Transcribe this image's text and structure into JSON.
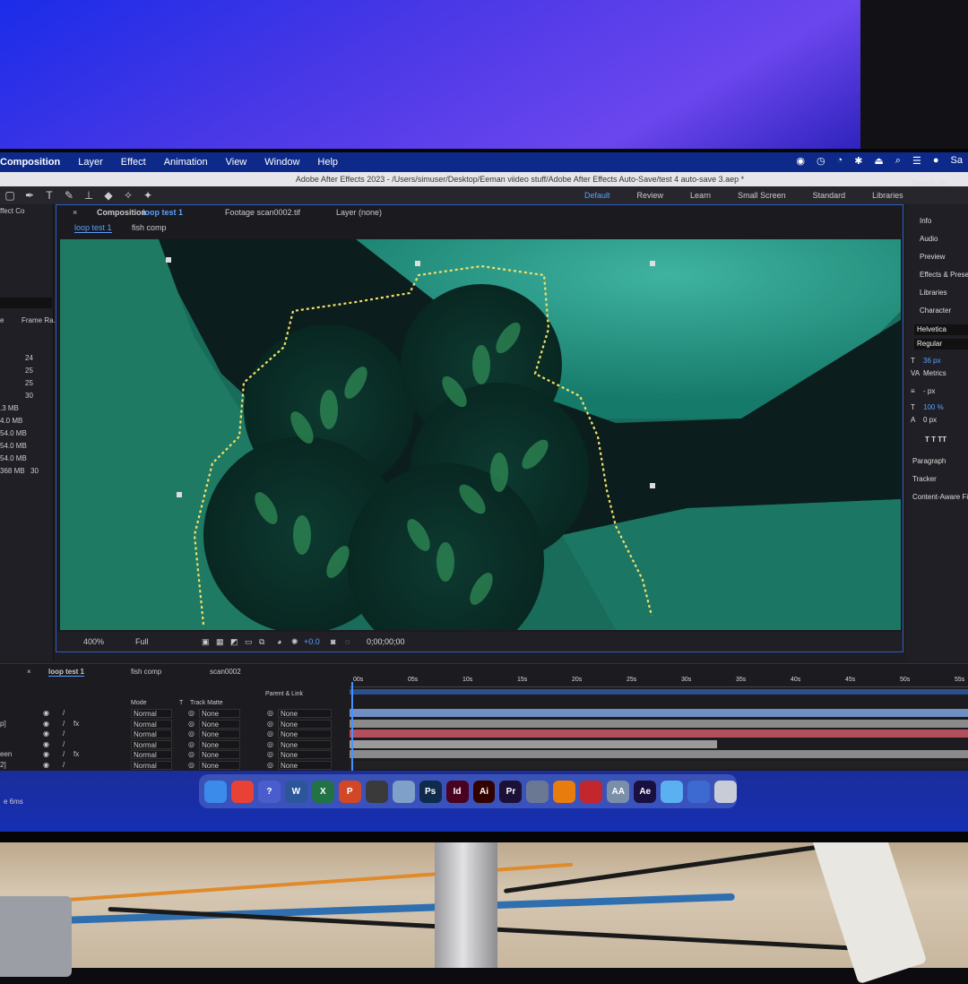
{
  "menubar": {
    "items": [
      "Composition",
      "Layer",
      "Effect",
      "Animation",
      "View",
      "Window",
      "Help"
    ],
    "right_label": "Sa"
  },
  "window_title": "Adobe After Effects 2023 - /Users/simuser/Desktop/Eeman viideo stuff/Adobe After Effects Auto-Save/test 4 auto-save 3.aep *",
  "workspaces": [
    "Default",
    "Review",
    "Learn",
    "Small Screen",
    "Standard",
    "Libraries"
  ],
  "project_panel": {
    "label": "ffect Co",
    "column_a": "e",
    "column_b": "Frame Ra...",
    "frame_rates": [
      "24",
      "25",
      "25",
      "30"
    ],
    "sizes": [
      ".3 MB",
      "4.0 MB",
      "54.0 MB",
      "54.0 MB",
      "54.0 MB",
      "368 MB"
    ],
    "last_rate": "30"
  },
  "composition": {
    "tab_label": "Composition",
    "tab_name": "loop test 1",
    "footage_tab": "Footage scan0002.tif",
    "layer_tab": "Layer (none)",
    "subtabs": [
      "loop test 1",
      "fish comp"
    ],
    "zoom": "400%",
    "resolution": "Full",
    "exposure": "+0.0",
    "timecode": "0;00;00;00"
  },
  "right_panels": {
    "items": [
      "Info",
      "Audio",
      "Preview",
      "Effects & Presets",
      "Libraries",
      "Character"
    ],
    "search_label": "Search He",
    "font": "Helvetica",
    "style": "Regular",
    "size": "36 px",
    "kerning": "Metrics",
    "leading": "- px",
    "scale": "100 %",
    "baseline": "0 px",
    "lower_items": [
      "Paragraph",
      "Tracker",
      "Content-Aware Fill"
    ]
  },
  "timeline": {
    "tabs": [
      "loop test 1",
      "fish comp",
      "scan0002"
    ],
    "headers": {
      "mode": "Mode",
      "t": "T",
      "track_matte": "Track Matte",
      "parent": "Parent & Link"
    },
    "ruler": [
      "00s",
      "05s",
      "10s",
      "15s",
      "20s",
      "25s",
      "30s",
      "35s",
      "40s",
      "45s",
      "50s",
      "55s"
    ],
    "rows": [
      {
        "name": "",
        "mode": "Normal",
        "matte": "None",
        "parent": "None",
        "fx": ""
      },
      {
        "name": "p]",
        "mode": "Normal",
        "matte": "None",
        "parent": "None",
        "fx": "fx"
      },
      {
        "name": "",
        "mode": "Normal",
        "matte": "None",
        "parent": "None",
        "fx": ""
      },
      {
        "name": "",
        "mode": "Normal",
        "matte": "None",
        "parent": "None",
        "fx": ""
      },
      {
        "name": "een",
        "mode": "Normal",
        "matte": "None",
        "parent": "None",
        "fx": "fx"
      },
      {
        "name": "2]",
        "mode": "Normal",
        "matte": "None",
        "parent": "None",
        "fx": ""
      }
    ],
    "bar_colors": [
      "#6f8fc4",
      "#8a8a8a",
      "#b4505e",
      "#9a9a9a",
      "#8a8a8a",
      "#222"
    ]
  },
  "status": "e 6ms",
  "dock_icons": [
    {
      "name": "finder-icon",
      "label": "",
      "color": "#3b8bea"
    },
    {
      "name": "chrome-icon",
      "label": "",
      "color": "#e94235"
    },
    {
      "name": "help-icon",
      "label": "?",
      "color": "#4a5dcc"
    },
    {
      "name": "word-icon",
      "label": "W",
      "color": "#2b579a"
    },
    {
      "name": "excel-icon",
      "label": "X",
      "color": "#217346"
    },
    {
      "name": "powerpoint-icon",
      "label": "P",
      "color": "#d24726"
    },
    {
      "name": "clapper-icon",
      "label": "",
      "color": "#3a3a3a"
    },
    {
      "name": "preview-icon",
      "label": "",
      "color": "#7fa0c8"
    },
    {
      "name": "photoshop-icon",
      "label": "Ps",
      "color": "#0f2a4a"
    },
    {
      "name": "indesign-icon",
      "label": "Id",
      "color": "#49021f"
    },
    {
      "name": "illustrator-icon",
      "label": "Ai",
      "color": "#330000"
    },
    {
      "name": "premiere-icon",
      "label": "Pr",
      "color": "#1c1037"
    },
    {
      "name": "dragonframe-icon",
      "label": "",
      "color": "#6a7894"
    },
    {
      "name": "blender-icon",
      "label": "",
      "color": "#e87d0d"
    },
    {
      "name": "sketchup-icon",
      "label": "",
      "color": "#c4262e"
    },
    {
      "name": "font-book-icon",
      "label": "AA",
      "color": "#7b8fa8"
    },
    {
      "name": "after-effects-icon",
      "label": "Ae",
      "color": "#1a1040"
    },
    {
      "name": "folder-icon",
      "label": "",
      "color": "#5ab0f0"
    },
    {
      "name": "screen-icon",
      "label": "",
      "color": "#3c6ad0"
    },
    {
      "name": "trash-icon",
      "label": "",
      "color": "#c8ccd6"
    }
  ]
}
